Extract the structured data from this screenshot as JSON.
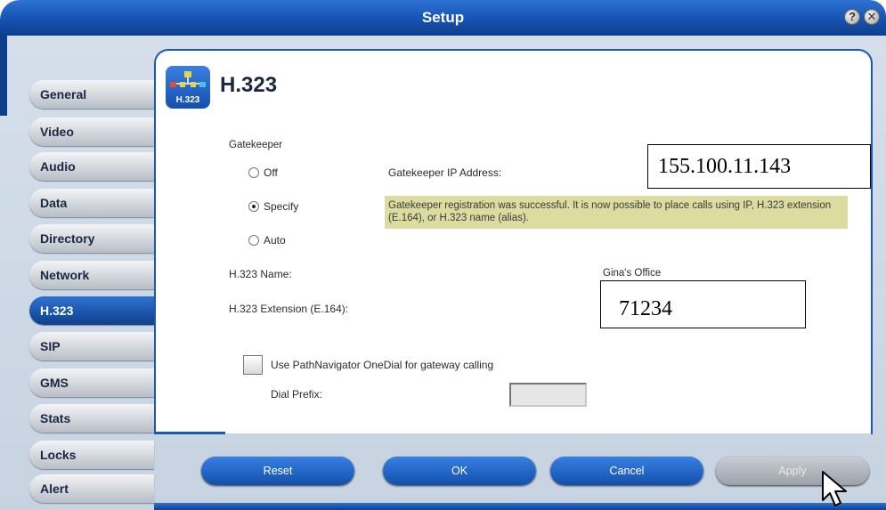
{
  "window": {
    "title": "Setup"
  },
  "titlebar": {
    "help_glyph": "?",
    "close_glyph": "✕"
  },
  "sidebar": {
    "items": [
      {
        "label": "General"
      },
      {
        "label": "Video"
      },
      {
        "label": "Audio"
      },
      {
        "label": "Data"
      },
      {
        "label": "Directory"
      },
      {
        "label": "Network"
      },
      {
        "label": "H.323",
        "active": true
      },
      {
        "label": "SIP"
      },
      {
        "label": "GMS"
      },
      {
        "label": "Stats"
      },
      {
        "label": "Locks"
      },
      {
        "label": "Alert"
      }
    ]
  },
  "section": {
    "icon_label": "H.323",
    "title": "H.323"
  },
  "gatekeeper": {
    "heading": "Gatekeeper",
    "options": [
      "Off",
      "Specify",
      "Auto"
    ],
    "selected": "Specify",
    "ip_label": "Gatekeeper IP Address:",
    "ip_value": "155.100.11.143",
    "status_message": "Gatekeeper registration was successful. It is now possible to place calls using IP, H.323 extension (E.164), or H.323 name (alias)."
  },
  "h323": {
    "name_label": "H.323 Name:",
    "name_value": "Gina's Office",
    "extension_label": "H.323 Extension (E.164):",
    "extension_value": "71234"
  },
  "onedial": {
    "checkbox_label": "Use PathNavigator OneDial for gateway calling",
    "checked": false,
    "prefix_label": "Dial Prefix:",
    "prefix_value": ""
  },
  "buttons": {
    "reset": "Reset",
    "ok": "OK",
    "cancel": "Cancel",
    "apply": "Apply"
  },
  "colors": {
    "accent_blue": "#1552b3",
    "status_bg": "#dcdca0"
  }
}
